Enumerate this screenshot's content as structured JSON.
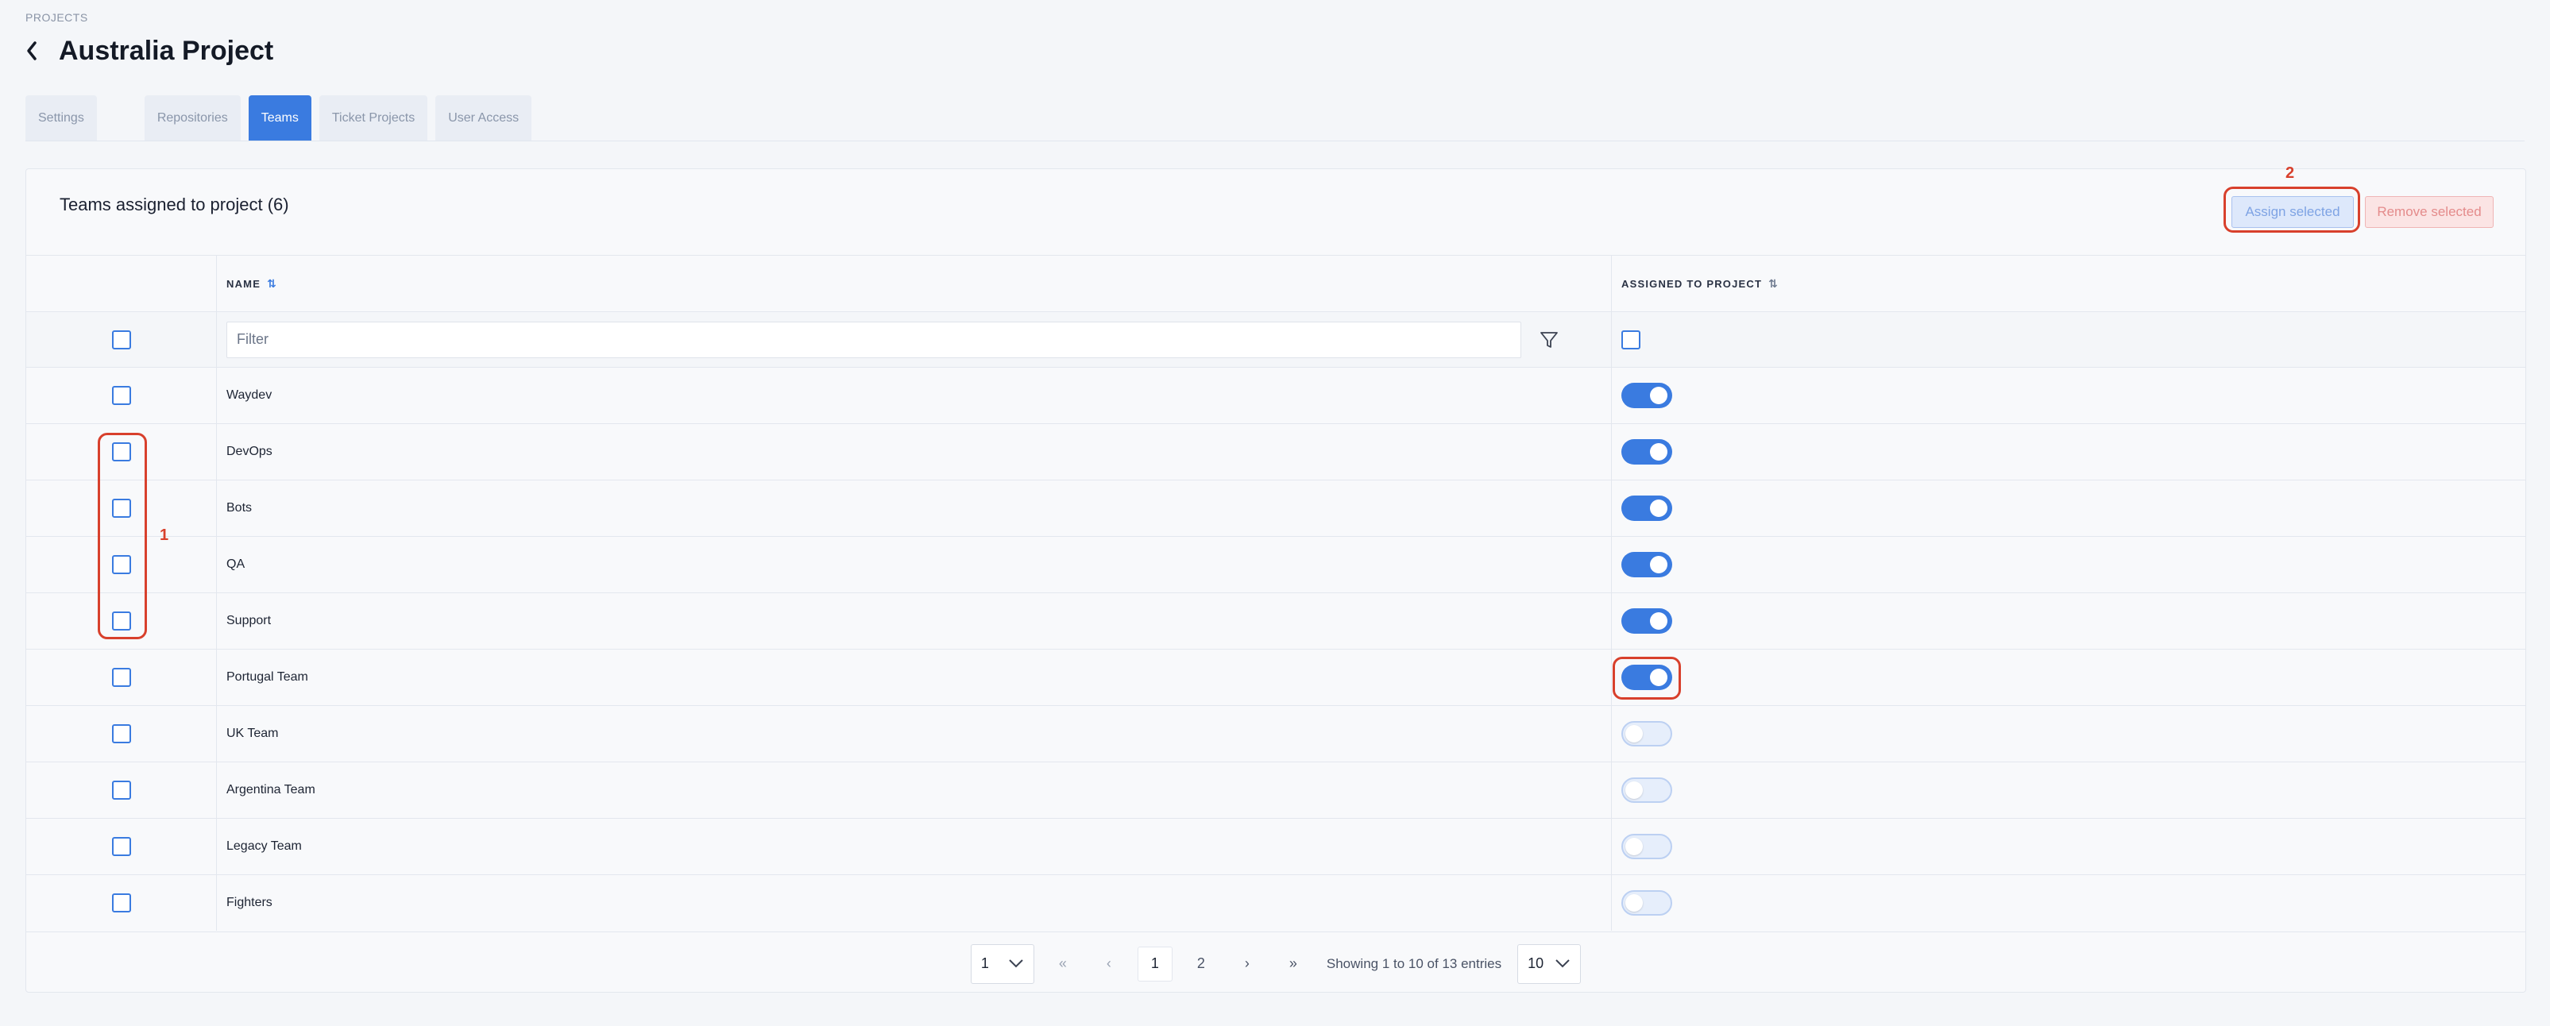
{
  "breadcrumb": "PROJECTS",
  "page_title": "Australia Project",
  "tabs": [
    {
      "label": "Settings",
      "active": false
    },
    {
      "label": "Repositories",
      "active": false
    },
    {
      "label": "Teams",
      "active": true
    },
    {
      "label": "Ticket Projects",
      "active": false
    },
    {
      "label": "User Access",
      "active": false
    }
  ],
  "card": {
    "title": "Teams assigned to project (6)",
    "assign_label": "Assign selected",
    "remove_label": "Remove selected"
  },
  "annotations": {
    "one": "1",
    "two": "2"
  },
  "table": {
    "headers": {
      "name": "NAME",
      "assigned": "ASSIGNED TO PROJECT"
    },
    "filter_placeholder": "Filter",
    "rows": [
      {
        "name": "Waydev",
        "assigned": true
      },
      {
        "name": "DevOps",
        "assigned": true
      },
      {
        "name": "Bots",
        "assigned": true
      },
      {
        "name": "QA",
        "assigned": true
      },
      {
        "name": "Support",
        "assigned": true
      },
      {
        "name": "Portugal Team",
        "assigned": true
      },
      {
        "name": "UK Team",
        "assigned": false
      },
      {
        "name": "Argentina Team",
        "assigned": false
      },
      {
        "name": "Legacy Team",
        "assigned": false
      },
      {
        "name": "Fighters",
        "assigned": false
      }
    ]
  },
  "pagination": {
    "page_select": "1",
    "pages": [
      "1",
      "2"
    ],
    "current_page": "1",
    "info": "Showing 1 to 10 of 13 entries",
    "page_size": "10"
  },
  "colors": {
    "accent": "#3a7be0",
    "annotation": "#d8402c"
  }
}
